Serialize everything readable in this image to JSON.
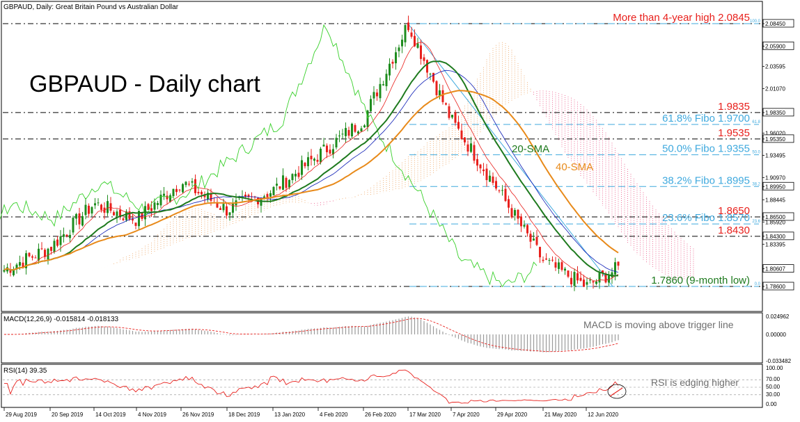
{
  "header": {
    "symbol_line": "GBPAUD, Daily:  Great Britain Pound vs Australian Dollar"
  },
  "title": "GBPAUD - Daily chart",
  "price_axis": {
    "labels": [
      "2.08450",
      "2.05900",
      "2.03595",
      "2.01070",
      "1.98350",
      "1.96020",
      "1.95350",
      "1.93495",
      "1.90970",
      "1.89950",
      "1.88445",
      "1.86500",
      "1.85920",
      "1.84300",
      "1.83395",
      "1.80607",
      "1.78600"
    ],
    "highlighted": [
      "2.08450",
      "2.05900",
      "1.98350",
      "1.95350",
      "1.89950",
      "1.86500",
      "1.84300",
      "1.80607",
      "1.78600"
    ]
  },
  "levels": [
    {
      "price": 2.0845,
      "label": "More than 4-year high 2.0845",
      "color": "red",
      "pct": "100.0"
    },
    {
      "price": 1.9835,
      "label": "1.9835",
      "color": "red"
    },
    {
      "price": 1.97,
      "label": "61.8% Fibo 1.9700",
      "color": "blue",
      "pct": "61.8"
    },
    {
      "price": 1.9535,
      "label": "1.9535",
      "color": "red"
    },
    {
      "price": 1.9355,
      "label": "50.0% Fibo 1.9355",
      "color": "blue",
      "pct": "50.0"
    },
    {
      "price": 1.8995,
      "label": "38.2% Fibo 1.8995",
      "color": "blue",
      "pct": "38.2"
    },
    {
      "price": 1.865,
      "label": "1.8650",
      "color": "red"
    },
    {
      "price": 1.857,
      "label": "23.6% Fibo 1.8570",
      "color": "blue",
      "pct": "23.6"
    },
    {
      "price": 1.843,
      "label": "1.8430",
      "color": "red"
    },
    {
      "price": 1.786,
      "label": "1.7860 (9-month low)",
      "color": "green",
      "pct": "0.0"
    }
  ],
  "ma_labels": {
    "sma20": "20-SMA",
    "sma40": "40-SMA"
  },
  "macd": {
    "header": "MACD(12,26,9) -0.015814 -0.018133",
    "note": "MACD is moving above trigger line",
    "axis": [
      "0.024962",
      "0.00000",
      "-0.033482"
    ]
  },
  "rsi": {
    "header": "RSI(14) 39.35",
    "note": "RSI is edging higher",
    "axis": [
      "100.00",
      "70.00",
      "50.00",
      "30.00",
      "0.00"
    ]
  },
  "dates": [
    "29 Aug 2019",
    "20 Sep 2019",
    "14 Oct 2019",
    "4 Nov 2019",
    "26 Nov 2019",
    "18 Dec 2019",
    "13 Jan 2020",
    "4 Feb 2020",
    "26 Feb 2020",
    "17 Mar 2020",
    "7 Apr 2020",
    "29 Apr 2020",
    "21 May 2020",
    "12 Jun 2020"
  ],
  "colors": {
    "bull": "#1e8c1e",
    "bear": "#e8201c",
    "sma20": "#1e7a1e",
    "sma40": "#e88a1a",
    "kijun": "#0b1bb5",
    "chikou": "#38d02a",
    "cloud_bull": "#f0b27a",
    "cloud_bear": "#ee6f98",
    "fibo": "#3fa9de"
  },
  "chart_data": {
    "type": "candlestick",
    "title": "GBPAUD - Daily chart",
    "symbol": "GBPAUD",
    "timeframe": "Daily",
    "ylim": [
      1.778,
      2.09
    ],
    "key_points": [
      {
        "date": "29 Aug 2019",
        "close": 1.805
      },
      {
        "date": "20 Sep 2019",
        "close": 1.83
      },
      {
        "date": "14 Oct 2019",
        "close": 1.88
      },
      {
        "date": "4 Nov 2019",
        "close": 1.862
      },
      {
        "date": "26 Nov 2019",
        "close": 1.905
      },
      {
        "date": "18 Dec 2019",
        "close": 1.873
      },
      {
        "date": "13 Jan 2020",
        "close": 1.895
      },
      {
        "date": "4 Feb 2020",
        "close": 1.935
      },
      {
        "date": "26 Feb 2020",
        "close": 1.975
      },
      {
        "date": "17 Mar 2020",
        "close": 2.0845
      },
      {
        "date": "7 Apr 2020",
        "close": 1.975
      },
      {
        "date": "29 Apr 2020",
        "close": 1.9
      },
      {
        "date": "21 May 2020",
        "close": 1.815
      },
      {
        "date": "12 Jun 2020",
        "close": 1.786
      }
    ],
    "annotations": [
      "More than 4-year high 2.0845",
      "1.7860 (9-month low)",
      "20-SMA",
      "40-SMA"
    ]
  }
}
